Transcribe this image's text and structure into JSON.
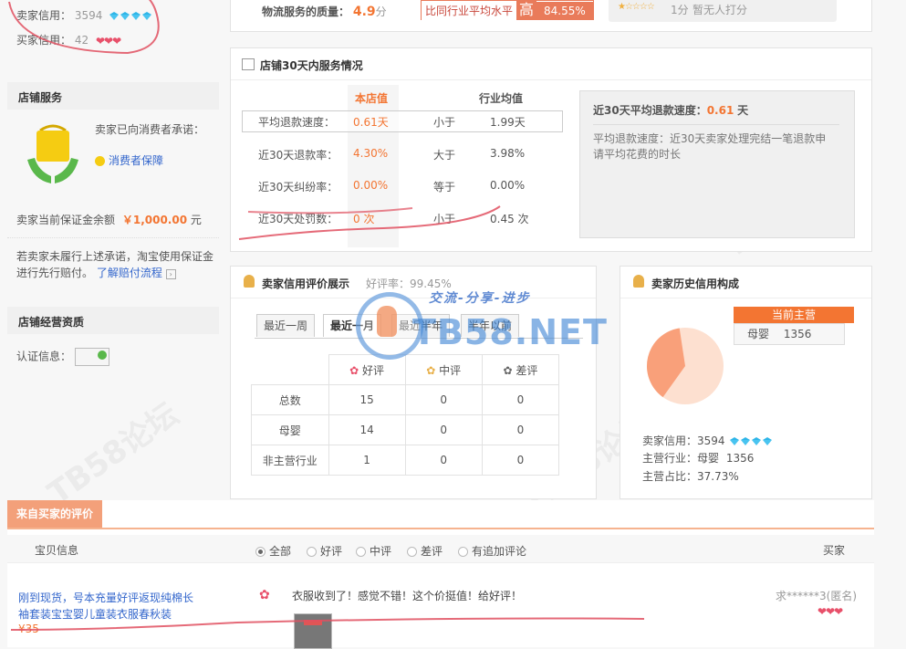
{
  "left": {
    "seller_credit_label": "卖家信用：",
    "seller_credit_value": "3594",
    "buyer_credit_label": "买家信用：",
    "buyer_credit_value": "42",
    "service_title": "店铺服务",
    "promise_text": "卖家已向消费者承诺：",
    "consumer_link": "消费者保障",
    "deposit_label": "卖家当前保证金余额",
    "deposit_value": "￥1,000.00",
    "deposit_unit": "元",
    "note_text": "若卖家未履行上述承诺，淘宝使用保证金进行先行赔付。",
    "note_link": "了解赔付流程",
    "qualification_title": "店铺经营资质",
    "cert_label": "认证信息："
  },
  "top": {
    "logistics_label": "物流服务的质量：",
    "logistics_score": "4.9",
    "logistics_unit": "分",
    "compare_text": "比同行业平均水平",
    "compare_word": "高",
    "compare_pct": "84.55%",
    "rating_count": "1",
    "rating_unit": "分",
    "rating_none": "暂无人打分"
  },
  "service30": {
    "title": "店铺30天内服务情况",
    "col_store": "本店值",
    "col_industry": "行业均值",
    "rows": [
      {
        "label": "平均退款速度：",
        "value": "0.61天",
        "cmp": "小于",
        "industry": "1.99天"
      },
      {
        "label": "近30天退款率：",
        "value": "4.30%",
        "cmp": "大于",
        "industry": "3.98%"
      },
      {
        "label": "近30天纠纷率：",
        "value": "0.00%",
        "cmp": "等于",
        "industry": "0.00%"
      },
      {
        "label": "近30天处罚数：",
        "value": "0 次",
        "cmp": "小于",
        "industry": "0.45 次"
      }
    ],
    "tip_title": "近30天平均退款速度：",
    "tip_value": "0.61",
    "tip_unit": "天",
    "tip_desc": "平均退款速度：近30天卖家处理完结一笔退款申请平均花费的时长"
  },
  "rating": {
    "title": "卖家信用评价展示",
    "good_rate_label": "好评率：",
    "good_rate": "99.45%",
    "tabs": [
      "最近一周",
      "最近一月",
      "最近半年",
      "半年以前"
    ],
    "headers": [
      "好评",
      "中评",
      "差评"
    ],
    "rows": [
      {
        "label": "总数",
        "good": "15",
        "mid": "0",
        "bad": "0"
      },
      {
        "label": "母婴",
        "good": "14",
        "mid": "0",
        "bad": "0"
      },
      {
        "label": "非主营行业",
        "good": "1",
        "mid": "0",
        "bad": "0"
      }
    ]
  },
  "history": {
    "title": "卖家历史信用构成",
    "main_label": "当前主营",
    "main_cat": "母婴",
    "main_num": "1356",
    "credit_label": "卖家信用：",
    "credit_value": "3594",
    "industry_label": "主营行业：",
    "industry_value": "母婴",
    "industry_num": "1356",
    "ratio_label": "主营占比：",
    "ratio_value": "37.73%",
    "chart_main_pct": 37.73
  },
  "reviews": {
    "section_title": "来自买家的评价",
    "col_item": "宝贝信息",
    "filters": [
      "全部",
      "好评",
      "中评",
      "差评",
      "有追加评论"
    ],
    "col_buyer": "买家",
    "item_title": "刚到现货，号本充量好评返现纯棉长袖套装宝宝婴儿童装衣服春秋装",
    "item_price": "¥35",
    "comment": "衣服收到了！感觉不错！这个价挺值！给好评！",
    "buyer": "求******3(匿名)"
  },
  "watermark": {
    "slogan": "交流-分享-进步",
    "site": "TB58.NET"
  }
}
